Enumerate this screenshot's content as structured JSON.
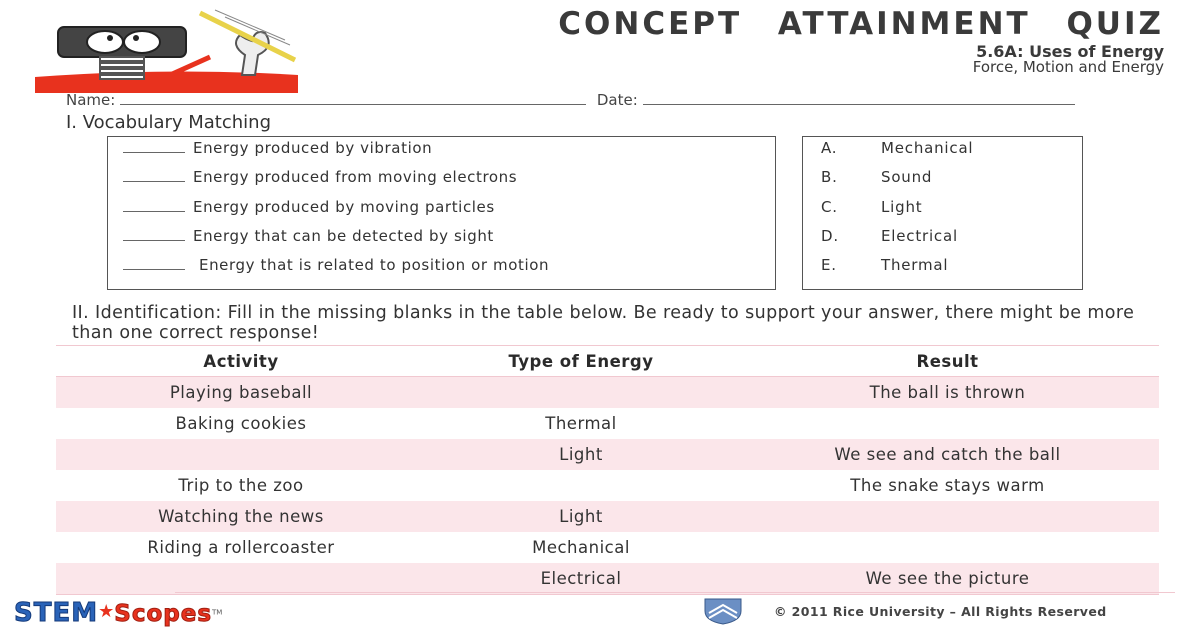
{
  "header": {
    "title": "CONCEPT ATTAINMENT QUIZ",
    "subtitle": "5.6A: Uses of Energy",
    "topic": "Force, Motion and Energy"
  },
  "form": {
    "name_label": "Name:",
    "date_label": "Date:"
  },
  "section1": {
    "heading": "I. Vocabulary Matching",
    "items": [
      "Energy produced by vibration",
      "Energy produced from moving electrons",
      "Energy produced by moving particles",
      "Energy that can be detected by sight",
      "Energy that is related to position or motion"
    ],
    "answers": [
      {
        "letter": "A.",
        "term": "Mechanical"
      },
      {
        "letter": "B.",
        "term": "Sound"
      },
      {
        "letter": "C.",
        "term": "Light"
      },
      {
        "letter": "D.",
        "term": "Electrical"
      },
      {
        "letter": "E.",
        "term": "Thermal"
      }
    ]
  },
  "section2": {
    "heading": "II. Identification: Fill in the missing blanks in the table below.  Be ready to support your answer, there might be more than one correct response!",
    "columns": [
      "Activity",
      "Type of Energy",
      "Result"
    ],
    "rows": [
      [
        "Playing baseball",
        "",
        "The ball is thrown"
      ],
      [
        "Baking cookies",
        "Thermal",
        ""
      ],
      [
        "",
        "Light",
        "We see and catch the ball"
      ],
      [
        "Trip to the zoo",
        "",
        "The snake stays warm"
      ],
      [
        "Watching the news",
        "Light",
        ""
      ],
      [
        "Riding a rollercoaster",
        "Mechanical",
        ""
      ],
      [
        "",
        "Electrical",
        "We see the picture"
      ]
    ]
  },
  "footer": {
    "brand_left": "STEM",
    "brand_right": "Scopes",
    "trademark": "TM",
    "copyright": "© 2011 Rice University – All Rights Reserved"
  },
  "colors": {
    "accent_red": "#e8321e",
    "row_pink": "#fbe6ea",
    "border_pink": "#f1c8d0",
    "stem_blue": "#2a63b8"
  }
}
